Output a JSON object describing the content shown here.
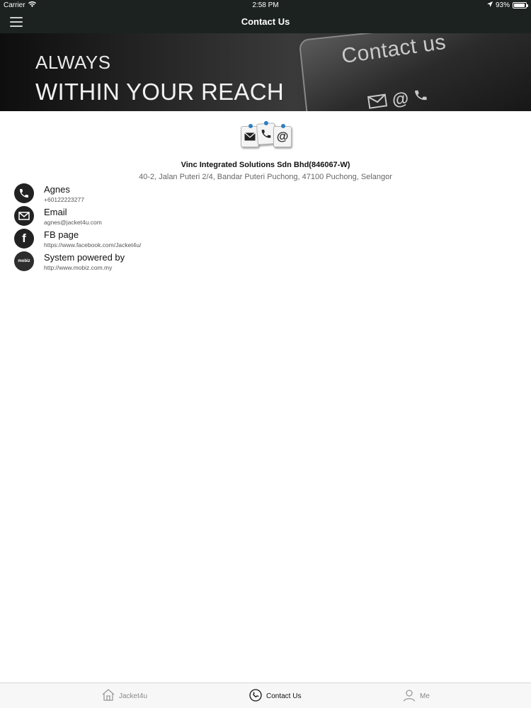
{
  "status_bar": {
    "carrier": "Carrier",
    "time": "2:58 PM",
    "battery_percent": "93%",
    "battery_level": 0.93
  },
  "nav": {
    "title": "Contact Us",
    "menu_icon": "hamburger-menu-icon"
  },
  "banner": {
    "line1": "ALWAYS",
    "line2": "WITHIN YOUR REACH",
    "plate_text": "Contact us"
  },
  "company": {
    "name": "Vinc Integrated Solutions Sdn Bhd(846067-W)",
    "address": "40-2, Jalan Puteri 2/4, Bandar Puteri Puchong, 47100 Puchong, Selangor"
  },
  "contacts": [
    {
      "label": "Agnes",
      "value": "+60122223277",
      "icon": "phone-icon"
    },
    {
      "label": "Email",
      "value": "agnes@jacket4u.com",
      "icon": "mail-icon"
    },
    {
      "label": "FB page",
      "value": "https://www.facebook.com/Jacket4u/",
      "icon": "facebook-icon"
    },
    {
      "label": "System powered by",
      "value": "http://www.mobiz.com.my",
      "icon": "mobiz-logo",
      "logo_text": "mobiz"
    }
  ],
  "tabs": [
    {
      "label": "Jacket4u",
      "icon": "home-icon",
      "active": false
    },
    {
      "label": "Contact Us",
      "icon": "phone-icon",
      "active": true
    },
    {
      "label": "Me",
      "icon": "user-icon",
      "active": false
    }
  ],
  "colors": {
    "nav_background": "#1c2220",
    "accent_pin": "#2e7fc3",
    "icon_circle": "#222222"
  }
}
